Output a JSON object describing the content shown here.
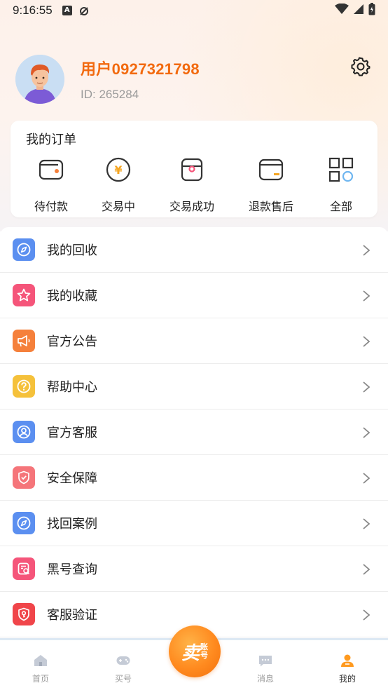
{
  "status_bar": {
    "time": "9:16:55",
    "a_badge": "A"
  },
  "profile": {
    "username": "用户0927321798",
    "user_id": "ID: 265284"
  },
  "orders": {
    "title": "我的订单",
    "items": [
      {
        "label": "待付款",
        "icon": "wallet-icon"
      },
      {
        "label": "交易中",
        "icon": "yuan-coin-icon"
      },
      {
        "label": "交易成功",
        "icon": "bag-check-icon"
      },
      {
        "label": "退款售后",
        "icon": "refund-card-icon"
      },
      {
        "label": "全部",
        "icon": "grid-icon"
      }
    ]
  },
  "menu": {
    "items": [
      {
        "label": "我的回收",
        "icon": "compass-icon",
        "color": "#5b8ff0"
      },
      {
        "label": "我的收藏",
        "icon": "star-icon",
        "color": "#f5557a"
      },
      {
        "label": "官方公告",
        "icon": "megaphone-icon",
        "color": "#f5803b"
      },
      {
        "label": "帮助中心",
        "icon": "question-icon",
        "color": "#f5c13b"
      },
      {
        "label": "官方客服",
        "icon": "user-service-icon",
        "color": "#5b8ff0"
      },
      {
        "label": "安全保障",
        "icon": "shield-icon",
        "color": "#f5757a"
      },
      {
        "label": "找回案例",
        "icon": "compass-icon",
        "color": "#5b8ff0"
      },
      {
        "label": "黑号查询",
        "icon": "search-doc-icon",
        "color": "#f5557a"
      },
      {
        "label": "客服验证",
        "icon": "shield-key-icon",
        "color": "#f0454a"
      }
    ]
  },
  "bottom_nav": {
    "items": [
      {
        "label": "首页",
        "icon": "home-icon"
      },
      {
        "label": "买号",
        "icon": "gamepad-icon"
      },
      {
        "label": "消息",
        "icon": "message-icon"
      },
      {
        "label": "我的",
        "icon": "profile-icon"
      }
    ],
    "sell": {
      "main": "卖",
      "sub_top": "账",
      "sub_bottom": "号"
    }
  },
  "colors": {
    "accent": "#f26a0f",
    "inactive_nav": "#c5cbd6",
    "active_nav": "#ff9a1f"
  }
}
